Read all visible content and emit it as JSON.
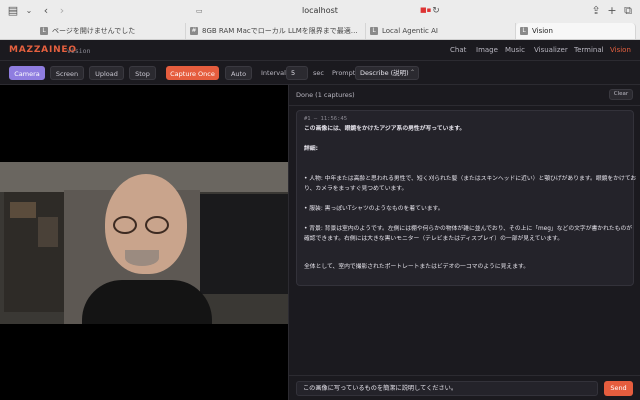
{
  "browser": {
    "url": "localhost",
    "tabs": [
      {
        "label": "ページを開けませんでした",
        "fav": "L"
      },
      {
        "label": "8GB RAM Macでローカル LLMを限界まで最適…",
        "fav": "#"
      },
      {
        "label": "Local Agentic AI",
        "fav": "L"
      },
      {
        "label": "Vision",
        "fav": "L"
      }
    ]
  },
  "app": {
    "brand": "MAZZAINEO",
    "brand_sub": "vision",
    "nav": [
      "Chat",
      "Image",
      "Music",
      "Visualizer",
      "Terminal",
      "Vision"
    ],
    "active_nav": "Vision",
    "accent_color": "#e5603f"
  },
  "toolbar": {
    "camera": "Camera",
    "screen": "Screen",
    "upload": "Upload",
    "stop": "Stop",
    "capture_once": "Capture Once",
    "auto": "Auto",
    "interval_label": "Interval",
    "interval_value": "5",
    "interval_unit": "sec",
    "prompt_label": "Prompt",
    "prompt_mode": "Describe (説明)"
  },
  "results": {
    "status": "Done (1 captures)",
    "clear": "Clear",
    "meta": "#1 — 11:56:45",
    "lines": [
      "この画像には、眼鏡をかけたアジア系の男性が写っています。",
      "詳細:",
      "• 人物: 中年または高齢と思われる男性で、短く刈られた髪（またはスキンヘッドに近い）と顎ひげがあります。眼鏡をかけてお",
      "り、カメラをまっすぐ見つめています。",
      "• 服装: 黒っぽいTシャツのようなものを着ています。",
      "• 背景: 背景は室内のようです。左側には棚や何らかの物体が雑に並んでおり、その上に「meg」などの文字が書かれたものが",
      "確認できます。右側には大きな黒いモニター（テレビまたはディスプレイ）の一部が見えています。",
      "全体として、室内で撮影されたポートレートまたはビデオの一コマのように見えます。"
    ]
  },
  "prompt": {
    "value": "この画像に写っているものを簡潔に説明してください。",
    "send": "Send"
  }
}
